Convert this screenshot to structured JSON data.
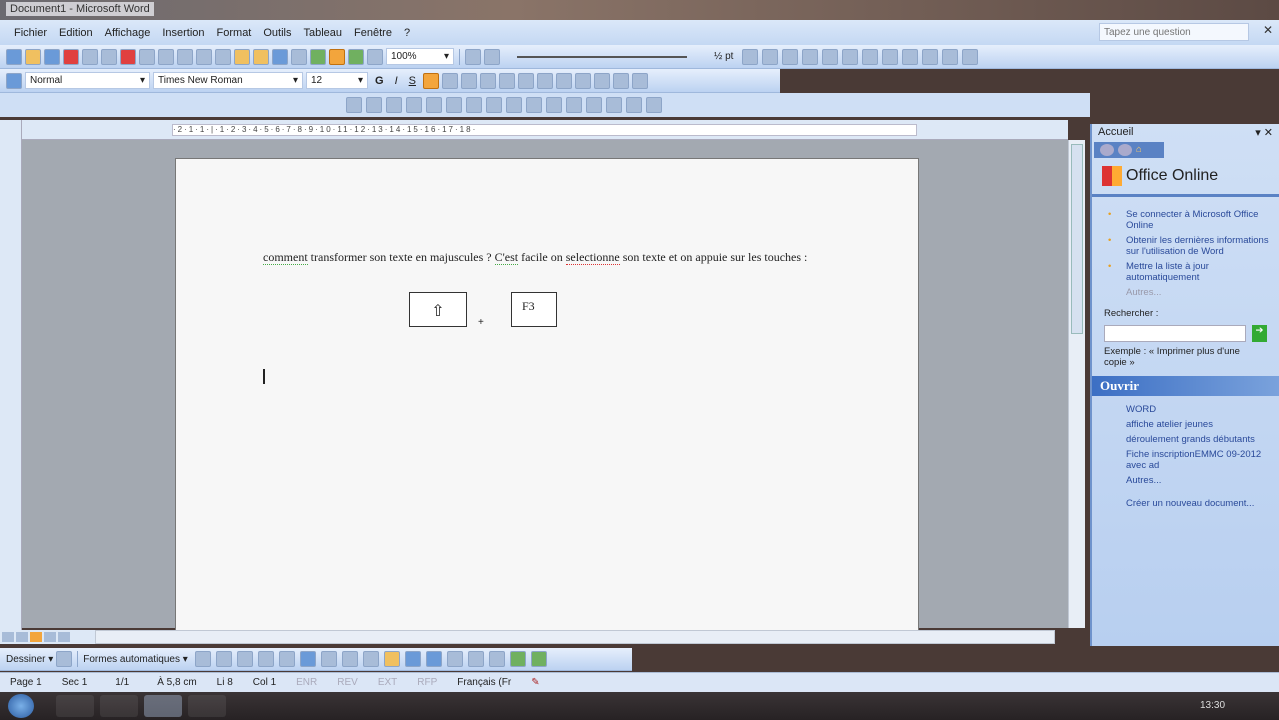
{
  "window": {
    "title": "Document1 - Microsoft Word"
  },
  "menu": [
    "Fichier",
    "Edition",
    "Affichage",
    "Insertion",
    "Format",
    "Outils",
    "Tableau",
    "Fenêtre",
    "?"
  ],
  "help": {
    "placeholder": "Tapez une question"
  },
  "toolbar_standard": {
    "icons": [
      "new-icon",
      "open-icon",
      "save-icon",
      "permission-icon",
      "email-icon",
      "print-icon",
      "pdf-icon",
      "print-preview-icon",
      "spelling-icon",
      "research-icon",
      "cut-icon",
      "copy-icon",
      "paste-icon",
      "format-painter-icon",
      "undo-icon",
      "redo-icon",
      "hyperlink-icon",
      "tables-borders-icon",
      "insert-table-icon",
      "show-hide-icon"
    ],
    "zoom": "100%"
  },
  "toolbar_format": {
    "style": "Normal",
    "font": "Times New Roman",
    "size": "12",
    "bold": "G",
    "italic": "I",
    "underline": "S"
  },
  "toolbar_right": {
    "size_label": "½ pt"
  },
  "document": {
    "w_comment": "comment",
    "t1": " transformer son texte en majuscules ? ",
    "w_cest": "C'est",
    "t2": " facile on ",
    "w_sel": "selectionne",
    "t3": " son texte et on appuie sur les touches :",
    "key_shift": "⇧",
    "plus": "+",
    "key_f3": "F3"
  },
  "task_pane": {
    "title": "Accueil",
    "logo": "Office Online",
    "links": [
      "Se connecter à Microsoft Office Online",
      "Obtenir les dernières informations sur l'utilisation de Word",
      "Mettre la liste à jour automatiquement"
    ],
    "more": "Autres...",
    "search_label": "Rechercher :",
    "example": "Exemple : « Imprimer plus d'une copie »",
    "open_title": "Ouvrir",
    "files": [
      "WORD",
      "affiche atelier jeunes",
      "déroulement grands débutants",
      "Fiche inscriptionEMMC 09-2012 avec ad"
    ],
    "open_more": "Autres...",
    "new_doc": "Créer un nouveau document..."
  },
  "drawing": {
    "draw": "Dessiner ▾",
    "autoshapes": "Formes automatiques ▾"
  },
  "status": {
    "page": "Page 1",
    "sec": "Sec 1",
    "pages": "1/1",
    "at": "À 5,8 cm",
    "line": "Li 8",
    "col": "Col 1",
    "enr": "ENR",
    "rev": "REV",
    "ext": "EXT",
    "rfp": "RFP",
    "lang": "Français (Fr"
  },
  "taskbar": {
    "clock": "13:30"
  }
}
